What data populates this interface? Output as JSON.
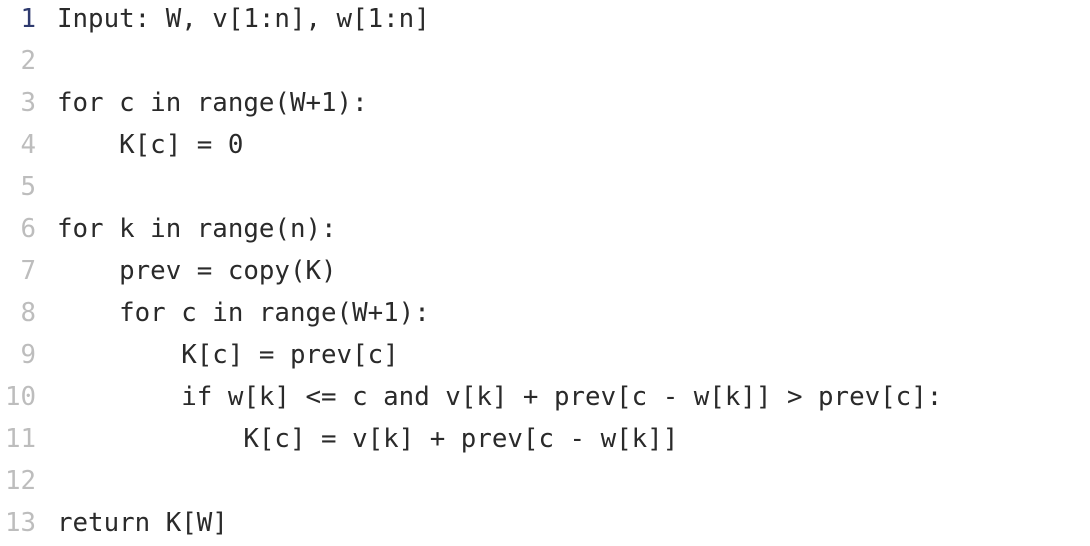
{
  "editor": {
    "active_line": 1,
    "lines": [
      {
        "number": "1",
        "text": "Input: W, v[1:n], w[1:n]"
      },
      {
        "number": "2",
        "text": ""
      },
      {
        "number": "3",
        "text": "for c in range(W+1):"
      },
      {
        "number": "4",
        "text": "    K[c] = 0"
      },
      {
        "number": "5",
        "text": ""
      },
      {
        "number": "6",
        "text": "for k in range(n):"
      },
      {
        "number": "7",
        "text": "    prev = copy(K)"
      },
      {
        "number": "8",
        "text": "    for c in range(W+1):"
      },
      {
        "number": "9",
        "text": "        K[c] = prev[c]"
      },
      {
        "number": "10",
        "text": "        if w[k] <= c and v[k] + prev[c - w[k]] > prev[c]:"
      },
      {
        "number": "11",
        "text": "            K[c] = v[k] + prev[c - w[k]]"
      },
      {
        "number": "12",
        "text": ""
      },
      {
        "number": "13",
        "text": "return K[W]"
      }
    ]
  },
  "colors": {
    "line_number": "#bdbdbd",
    "active_line_number": "#2e3a6e",
    "code_text": "#2a2a2a",
    "background": "#ffffff"
  }
}
